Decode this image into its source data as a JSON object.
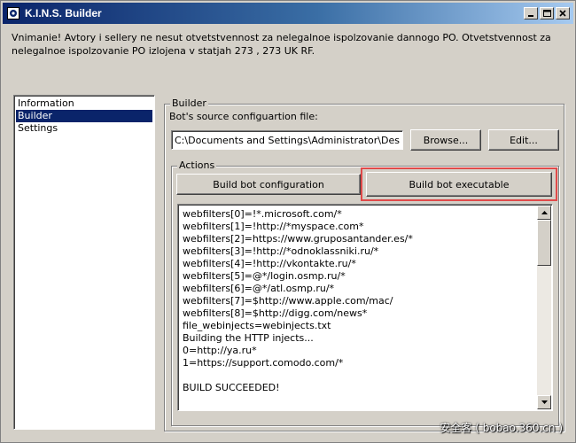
{
  "window": {
    "title": "K.I.N.S. Builder"
  },
  "warning_text": "Vnimanie! Avtory i sellery ne nesut otvetstvennost za nelegalnoe ispolzovanie dannogo PO. Otvetstvennost za nelegalnoe ispolzovanie PO izlojena v statjah 273 , 273 UK RF.",
  "nav": {
    "items": [
      {
        "label": "Information",
        "selected": false
      },
      {
        "label": "Builder",
        "selected": true
      },
      {
        "label": "Settings",
        "selected": false
      }
    ]
  },
  "builder": {
    "group_title": "Builder",
    "source_label": "Bot's source configuartion file:",
    "source_path": "C:\\Documents and Settings\\Administrator\\Desktop",
    "browse_label": "Browse...",
    "edit_label": "Edit..."
  },
  "actions": {
    "group_title": "Actions",
    "build_config_label": "Build bot configuration",
    "build_exe_label": "Build bot executable",
    "highlight_color": "#e04a4a"
  },
  "log": {
    "lines": [
      "webfilters[0]=!*.microsoft.com/*",
      "webfilters[1]=!http://*myspace.com*",
      "webfilters[2]=https://www.gruposantander.es/*",
      "webfilters[3]=!http://*odnoklassniki.ru/*",
      "webfilters[4]=!http://vkontakte.ru/*",
      "webfilters[5]=@*/login.osmp.ru/*",
      "webfilters[6]=@*/atl.osmp.ru/*",
      "webfilters[7]=$http://www.apple.com/mac/",
      "webfilters[8]=$http://digg.com/news*",
      "file_webinjects=webinjects.txt",
      "Building the HTTP injects...",
      "0=http://ya.ru*",
      "1=https://support.comodo.com/*",
      "",
      "BUILD SUCCEEDED!"
    ]
  },
  "watermark": "安全客 ( bobao.360.cn )",
  "colors": {
    "titlebar_start": "#0a246a",
    "titlebar_end": "#a6caf0",
    "selection": "#0a246a",
    "face": "#d4d0c8"
  }
}
